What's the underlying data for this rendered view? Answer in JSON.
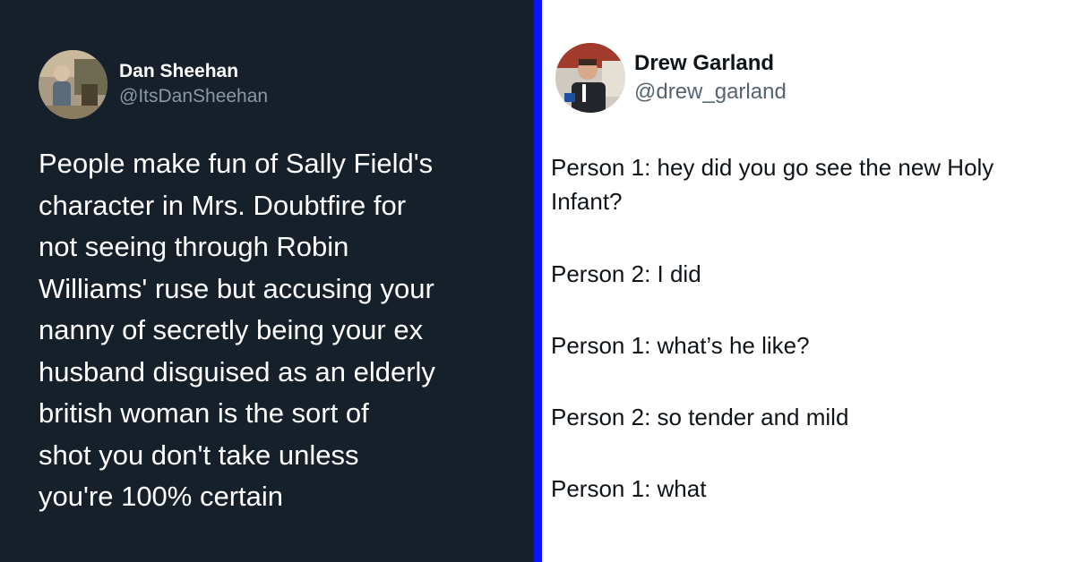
{
  "left_tweet": {
    "name": "Dan Sheehan",
    "handle": "@ItsDanSheehan",
    "text": "People make fun of Sally Field's\ncharacter in Mrs. Doubtfire for\nnot seeing through Robin\nWilliams' ruse but accusing your\nnanny of secretly being your ex\nhusband disguised as an elderly\nbritish woman is the sort of\nshot you don't take unless\nyou're 100% certain",
    "avatar_icon": "profile-photo"
  },
  "right_tweet": {
    "name": "Drew Garland",
    "handle": "@drew_garland",
    "avatar_icon": "profile-photo",
    "lines": [
      "Person 1: hey did you go see the new Holy Infant?",
      "Person 2: I did",
      "Person 1: what’s he like?",
      "Person 2: so tender and mild",
      "Person 1: what"
    ]
  },
  "colors": {
    "left_bg": "#15202b",
    "divider": "#0a14ff",
    "right_bg": "#ffffff"
  }
}
